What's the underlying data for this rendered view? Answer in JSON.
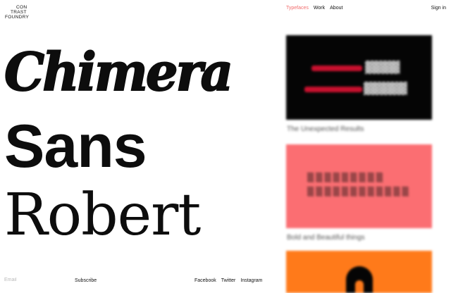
{
  "brand": {
    "logo_lines": [
      "CON",
      "TRAST",
      "FOUNDRY"
    ]
  },
  "nav": {
    "items": [
      {
        "label": "Typefaces",
        "active": true
      },
      {
        "label": "Work",
        "active": false
      },
      {
        "label": "About",
        "active": false
      }
    ],
    "signin_label": "Sign in"
  },
  "typefaces": [
    "Chimera",
    "Sans",
    "Robert"
  ],
  "footer": {
    "email_placeholder": "Email",
    "subscribe_label": "Subscribe",
    "social_links": [
      "Facebook",
      "Twitter",
      "Instagram"
    ]
  },
  "colors": {
    "accent": "#f26d6d",
    "card_black": "#050505",
    "card_pink": "#fb6e72",
    "card_orange": "#ff7a1a"
  },
  "cards": [
    {
      "caption": "The Unexpected Results"
    },
    {
      "caption": "Bold and Beautiful things"
    },
    {
      "caption": ""
    }
  ]
}
